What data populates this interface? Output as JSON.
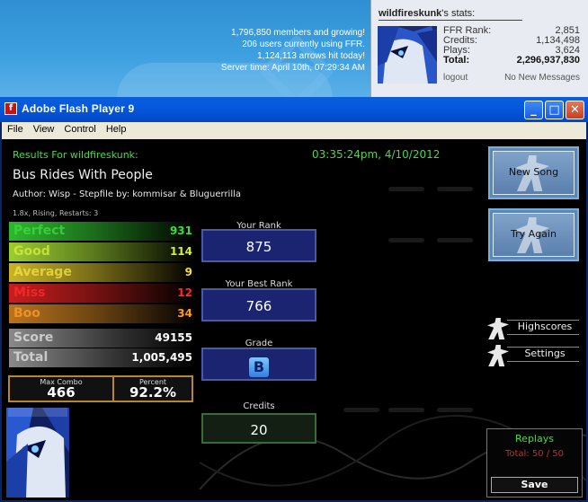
{
  "site": {
    "members_line": "1,796,850 members and growing!",
    "users_line": "206 users currently using FFR.",
    "arrows_line": "1,124,113 arrows hit today!",
    "server_time_line": "Server time: April 10th, 07:29:34 AM"
  },
  "user_panel": {
    "username": "wildfireskunk",
    "title_suffix": "'s stats:",
    "stats": [
      {
        "label": "FFR Rank:",
        "value": "2,851"
      },
      {
        "label": "Credits:",
        "value": "1,134,498"
      },
      {
        "label": "Plays:",
        "value": "3,624"
      },
      {
        "label": "Total:",
        "value": "2,296,937,830"
      }
    ],
    "logout_label": "logout",
    "messages_label": "No New Messages"
  },
  "window": {
    "title": "Adobe Flash Player 9",
    "minimize_glyph": "_",
    "maximize_glyph": "□",
    "close_glyph": "✕"
  },
  "menu": [
    "File",
    "View",
    "Control",
    "Help"
  ],
  "results": {
    "header": "Results For wildfireskunk:",
    "datetime": "03:35:24pm, 4/10/2012",
    "song_title": "Bus Rides With People",
    "author_line": "Author: Wisp   -   Stepfile by: kommisar & Bluguerrilla",
    "options_line": "1.8x, Rising, Restarts: 3",
    "judgements": [
      {
        "label": "Perfect",
        "value": "931",
        "color": "#2eb82e",
        "text": "#3ddc3d"
      },
      {
        "label": "Good",
        "value": "114",
        "color": "#9acd32",
        "text": "#d4ee3c"
      },
      {
        "label": "Average",
        "value": "9",
        "color": "#c8b428",
        "text": "#f2e040"
      },
      {
        "label": "Miss",
        "value": "12",
        "color": "#c81e1e",
        "text": "#ff2a2a"
      },
      {
        "label": "Boo",
        "value": "34",
        "color": "#b8741e",
        "text": "#ff9a2a"
      }
    ],
    "score_label": "Score",
    "score": "49155",
    "total_label": "Total",
    "total": "1,005,495",
    "max_combo_label": "Max Combo",
    "max_combo": "466",
    "percent_label": "Percent",
    "percent": "92.2%",
    "your_rank_label": "Your Rank",
    "your_rank": "875",
    "best_rank_label": "Your Best Rank",
    "best_rank": "766",
    "grade_label": "Grade",
    "grade": "B",
    "credits_label": "Credits",
    "credits": "20"
  },
  "buttons": {
    "new_song": "New Song",
    "try_again": "Try Again",
    "highscores": "Highscores",
    "settings": "Settings",
    "replays": "Replays",
    "replays_total": "Total: 50 / 50",
    "save": "Save"
  }
}
